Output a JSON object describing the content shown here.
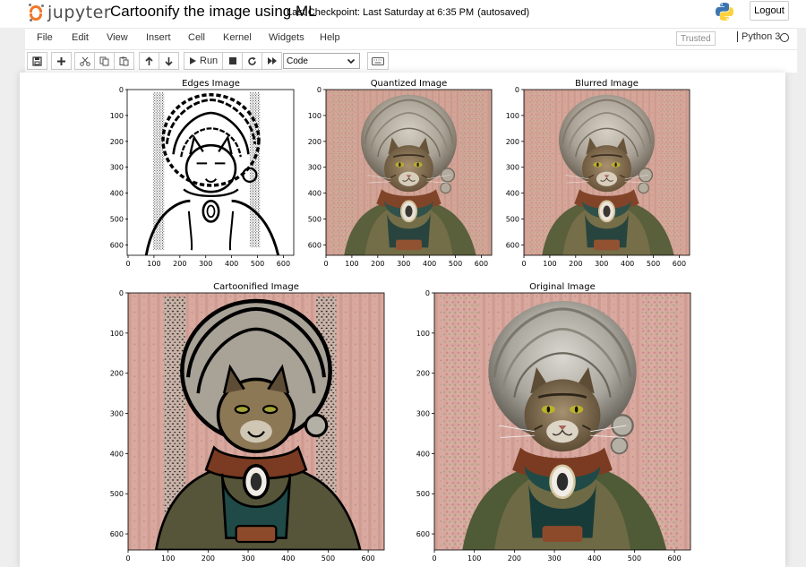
{
  "header": {
    "logo_text": "jupyter",
    "notebook_title": "Cartoonify the image using ML",
    "checkpoint": "Last Checkpoint: Last Saturday at 6:35 PM",
    "autosave": "(autosaved)",
    "logout": "Logout"
  },
  "menubar": {
    "items": [
      "File",
      "Edit",
      "View",
      "Insert",
      "Cell",
      "Kernel",
      "Widgets",
      "Help"
    ],
    "trusted": "Trusted",
    "kernel": "Python 3"
  },
  "toolbar": {
    "run_label": "Run",
    "cell_type": "Code",
    "icons": [
      "save-icon",
      "plus-icon",
      "cut-icon",
      "copy-icon",
      "paste-icon",
      "arrow-up-icon",
      "arrow-down-icon",
      "play-icon",
      "stop-icon",
      "restart-icon",
      "fast-forward-icon",
      "keyboard-icon"
    ]
  },
  "chart_data": [
    {
      "type": "image",
      "title": "Edges Image",
      "xticks": [
        0,
        100,
        200,
        300,
        400,
        500,
        600
      ],
      "yticks": [
        0,
        100,
        200,
        300,
        400,
        500,
        600
      ],
      "xlim": [
        0,
        640
      ],
      "ylim": [
        640,
        0
      ]
    },
    {
      "type": "image",
      "title": "Quantized Image",
      "xticks": [
        0,
        100,
        200,
        300,
        400,
        500,
        600
      ],
      "yticks": [
        0,
        100,
        200,
        300,
        400,
        500,
        600
      ],
      "xlim": [
        0,
        640
      ],
      "ylim": [
        640,
        0
      ]
    },
    {
      "type": "image",
      "title": "Blurred Image",
      "xticks": [
        0,
        100,
        200,
        300,
        400,
        500,
        600
      ],
      "yticks": [
        0,
        100,
        200,
        300,
        400,
        500,
        600
      ],
      "xlim": [
        0,
        640
      ],
      "ylim": [
        640,
        0
      ]
    },
    {
      "type": "image",
      "title": "Cartoonified Image",
      "xticks": [
        0,
        100,
        200,
        300,
        400,
        500,
        600
      ],
      "yticks": [
        0,
        100,
        200,
        300,
        400,
        500,
        600
      ],
      "xlim": [
        0,
        640
      ],
      "ylim": [
        640,
        0
      ]
    },
    {
      "type": "image",
      "title": "Original Image",
      "xticks": [
        0,
        100,
        200,
        300,
        400,
        500,
        600
      ],
      "yticks": [
        0,
        100,
        200,
        300,
        400,
        500,
        600
      ],
      "xlim": [
        0,
        640
      ],
      "ylim": [
        640,
        0
      ]
    }
  ],
  "colors": {
    "jupyter_orange": "#f37726",
    "wallpaper_pink": "#d9a79e",
    "wig_gray": "#a9a7a0",
    "dress_teal": "#1f4a47",
    "collar_brown": "#7a3b22"
  }
}
